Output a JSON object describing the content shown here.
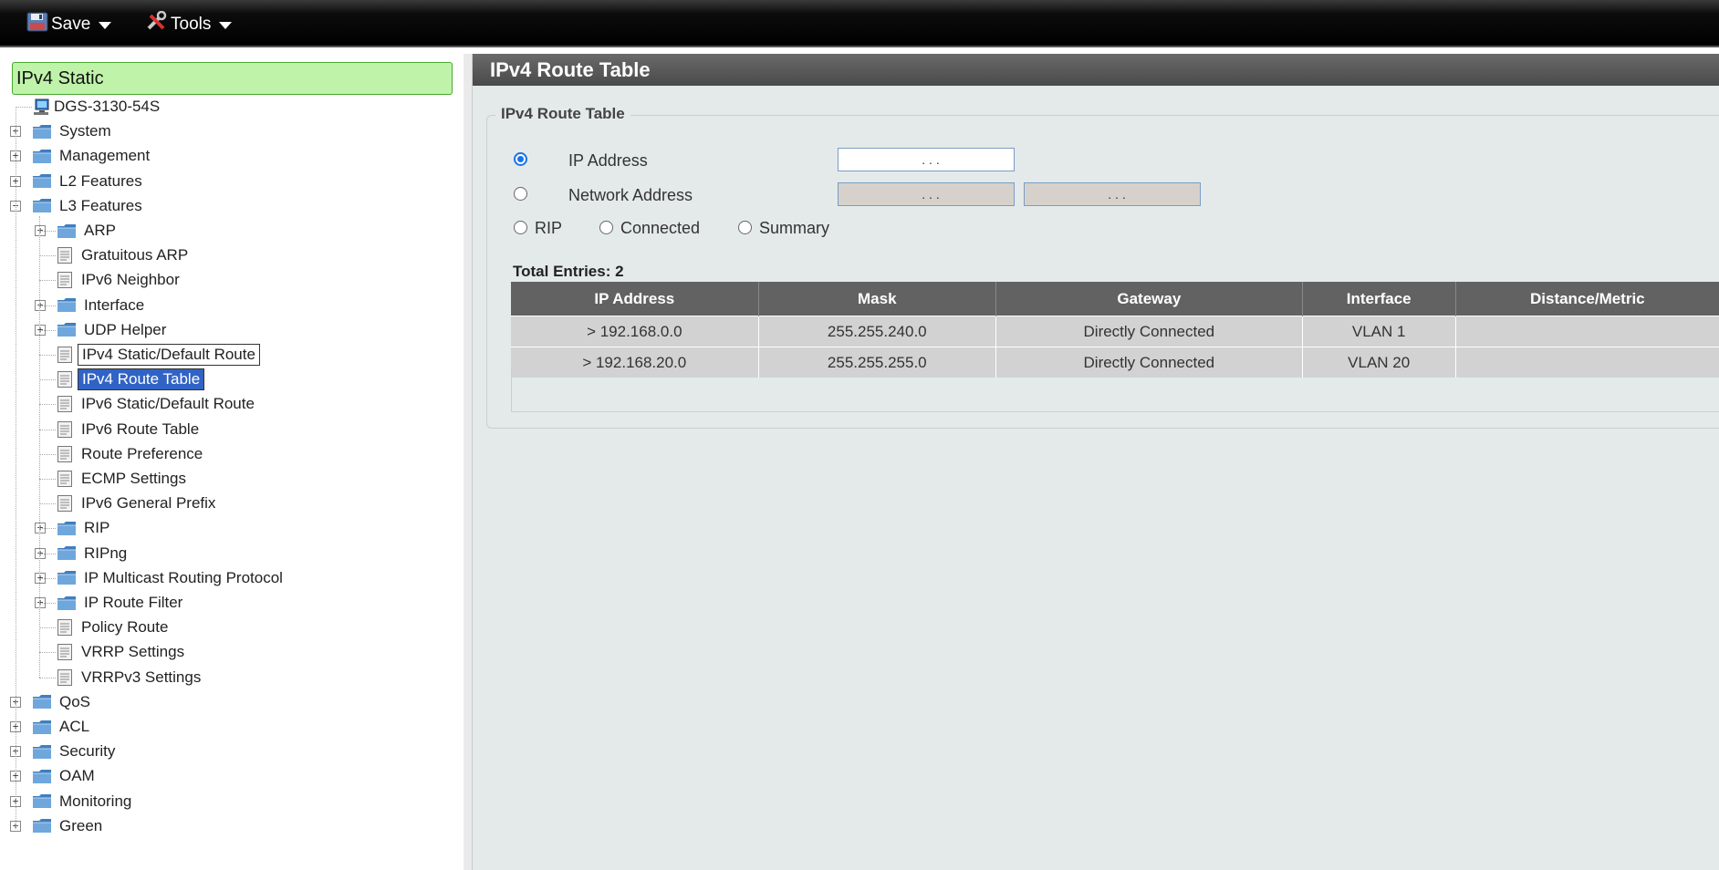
{
  "toolbar": {
    "save_label": "Save",
    "tools_label": "Tools"
  },
  "sidebar": {
    "search_value": "IPv4 Static",
    "root": "DGS-3130-54S",
    "top_items": [
      {
        "label": "System",
        "expander": "+"
      },
      {
        "label": "Management",
        "expander": "+"
      },
      {
        "label": "L2 Features",
        "expander": "+"
      },
      {
        "label": "L3 Features",
        "expander": "−"
      }
    ],
    "l3_children": [
      {
        "label": "ARP",
        "type": "folder",
        "expander": "+"
      },
      {
        "label": "Gratuitous ARP",
        "type": "page"
      },
      {
        "label": "IPv6 Neighbor",
        "type": "page"
      },
      {
        "label": "Interface",
        "type": "folder",
        "expander": "+"
      },
      {
        "label": "UDP Helper",
        "type": "folder",
        "expander": "+"
      },
      {
        "label": "IPv4 Static/Default Route",
        "type": "page",
        "state": "outlined"
      },
      {
        "label": "IPv4 Route Table",
        "type": "page",
        "state": "selected"
      },
      {
        "label": "IPv6 Static/Default Route",
        "type": "page"
      },
      {
        "label": "IPv6 Route Table",
        "type": "page"
      },
      {
        "label": "Route Preference",
        "type": "page"
      },
      {
        "label": "ECMP Settings",
        "type": "page"
      },
      {
        "label": "IPv6 General Prefix",
        "type": "page"
      },
      {
        "label": "RIP",
        "type": "folder",
        "expander": "+"
      },
      {
        "label": "RIPng",
        "type": "folder",
        "expander": "+"
      },
      {
        "label": "IP Multicast Routing Protocol",
        "type": "folder",
        "expander": "+"
      },
      {
        "label": "IP Route Filter",
        "type": "folder",
        "expander": "+"
      },
      {
        "label": "Policy Route",
        "type": "page"
      },
      {
        "label": "VRRP Settings",
        "type": "page"
      },
      {
        "label": "VRRPv3 Settings",
        "type": "page"
      }
    ],
    "bottom_items": [
      {
        "label": "QoS",
        "expander": "+"
      },
      {
        "label": "ACL",
        "expander": "+"
      },
      {
        "label": "Security",
        "expander": "+"
      },
      {
        "label": "OAM",
        "expander": "+"
      },
      {
        "label": "Monitoring",
        "expander": "+"
      },
      {
        "label": "Green",
        "expander": "+"
      }
    ]
  },
  "main": {
    "title": "IPv4 Route Table",
    "section_legend": "IPv4 Route Table",
    "filters": {
      "ip_address_label": "IP Address",
      "network_address_label": "Network Address",
      "rip_label": "RIP",
      "connected_label": "Connected",
      "summary_label": "Summary",
      "ip_dots": ".          .          .",
      "selected": "IP Address"
    },
    "total_entries": "Total Entries: 2",
    "table": {
      "headers": [
        "IP Address",
        "Mask",
        "Gateway",
        "Interface",
        "Distance/Metric"
      ],
      "rows": [
        [
          "> 192.168.0.0",
          "255.255.240.0",
          "Directly Connected",
          "VLAN 1",
          ""
        ],
        [
          "> 192.168.20.0",
          "255.255.255.0",
          "Directly Connected",
          "VLAN 20",
          ""
        ]
      ]
    }
  },
  "icons": {
    "save": "floppy-disk-icon",
    "tools": "tools-icon",
    "folder": "folder-icon",
    "page": "page-icon",
    "device": "switch-device-icon"
  },
  "colors": {
    "search_bg": "#bff3aa",
    "selected_bg": "#3163c5",
    "title_bar": "#555555",
    "radio_accent": "#1a73e8"
  }
}
